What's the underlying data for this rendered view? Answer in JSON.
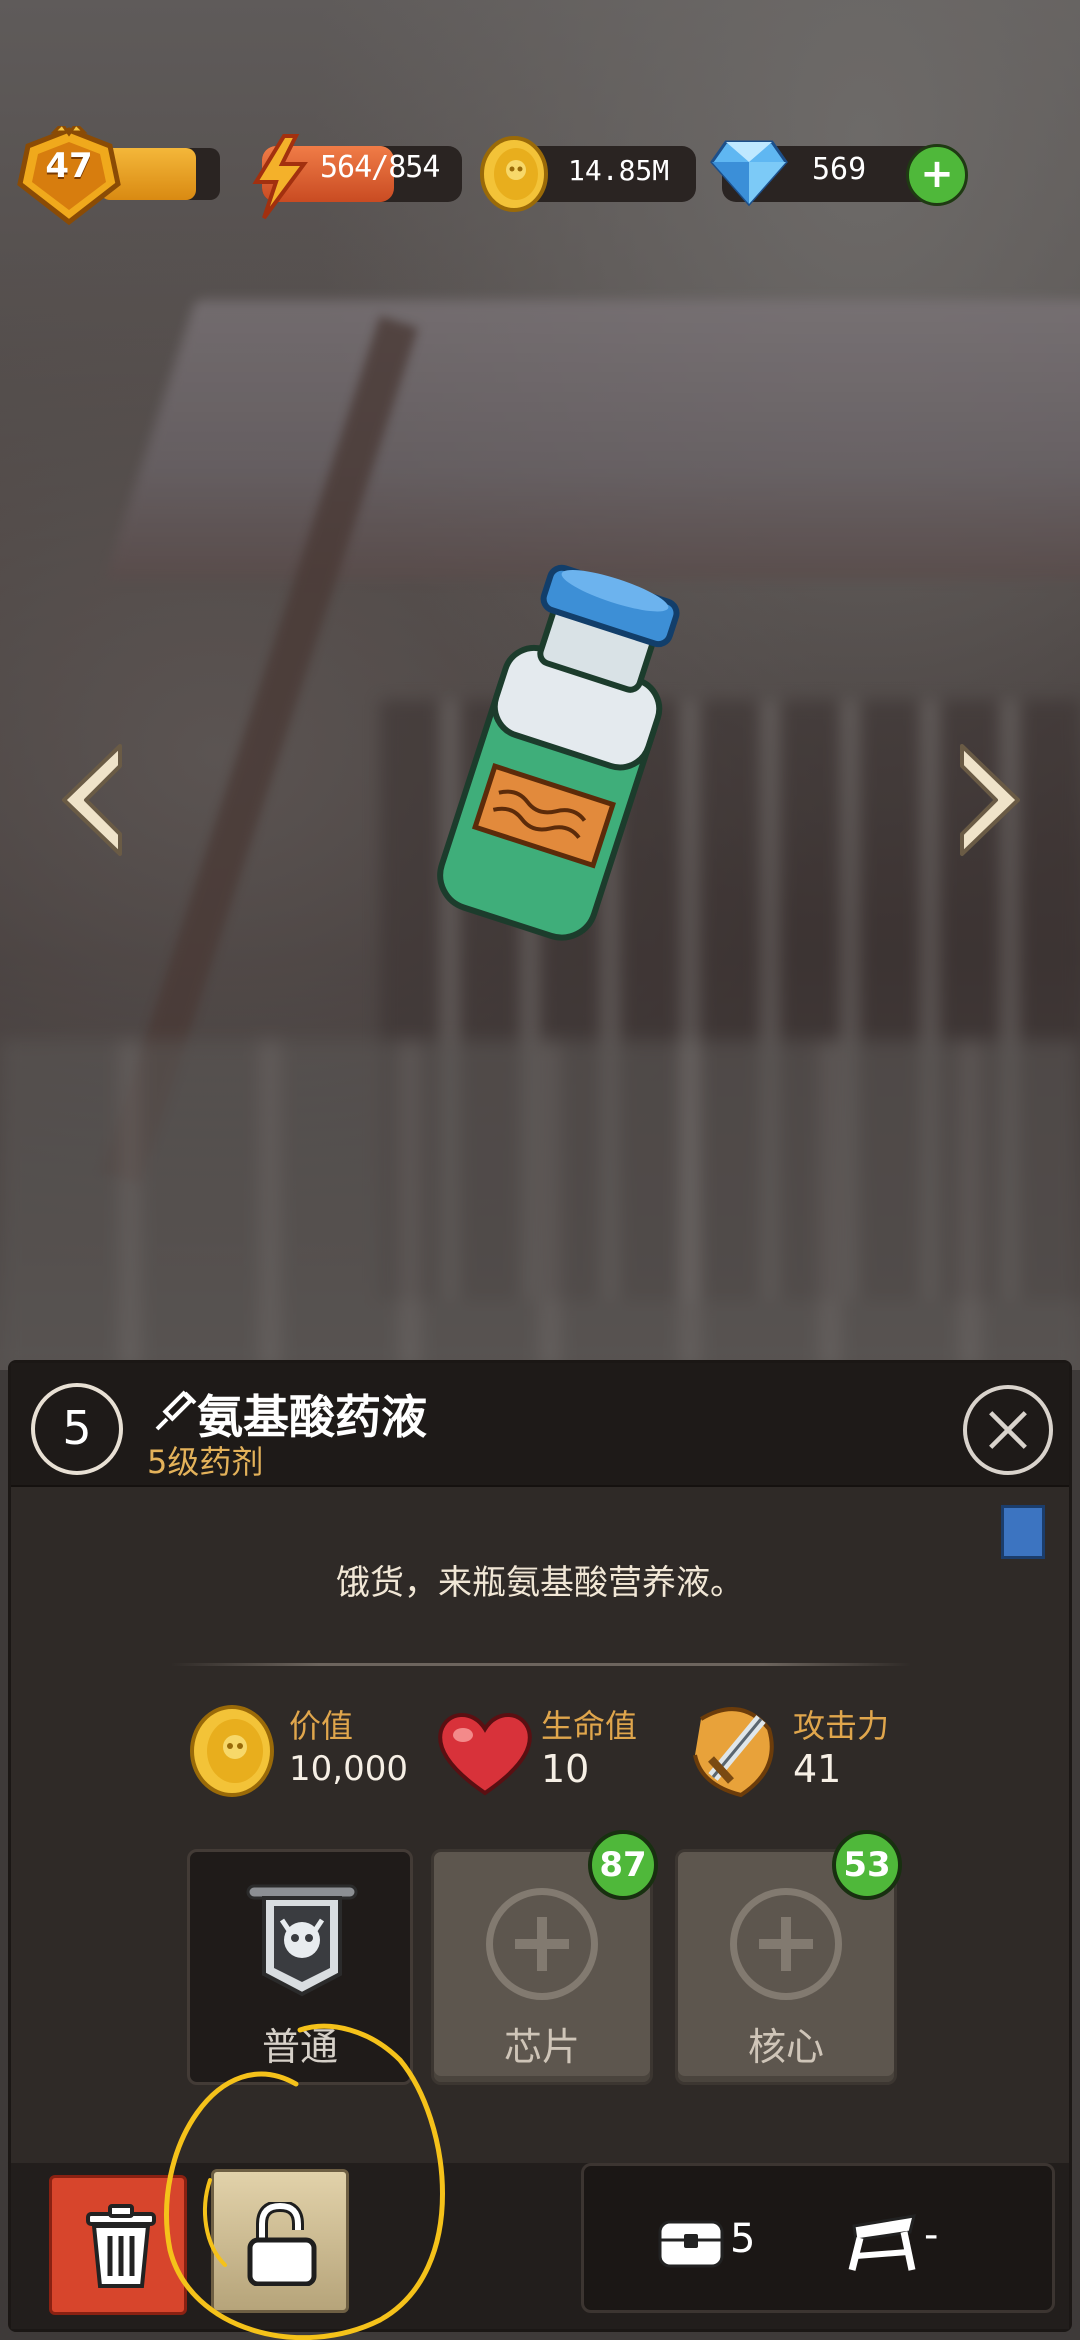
{
  "hud": {
    "player_level": "47",
    "xp_fraction": 0.8,
    "energy_text": "564/854",
    "energy_current": 564,
    "energy_max": 854,
    "gold_text": "14.85M",
    "gems_text": "569",
    "add_label": "+"
  },
  "item": {
    "level_number": "5",
    "name": "氨基酸药液",
    "grade": "5级药剂",
    "description": "饿货，来瓶氨基酸营养液。",
    "stats": [
      {
        "label": "价值",
        "value": "10,000",
        "icon": "gold-coin-icon"
      },
      {
        "label": "生命值",
        "value": "10",
        "icon": "heart-icon"
      },
      {
        "label": "攻击力",
        "value": "41",
        "icon": "sword-icon"
      }
    ],
    "slots": [
      {
        "label": "普通",
        "icon": "demon-banner-icon"
      },
      {
        "label": "芯片",
        "icon": "plus-icon",
        "count": "87"
      },
      {
        "label": "核心",
        "icon": "plus-icon",
        "count": "53"
      }
    ],
    "stack_count": "5",
    "equip_count": "-"
  },
  "colors": {
    "accent_gold": "#e4b25a",
    "badge_green": "#4fb83a",
    "trash_red": "#d7452c",
    "bottle_green": "#3fae7a",
    "cap_blue": "#3d8fd6"
  }
}
